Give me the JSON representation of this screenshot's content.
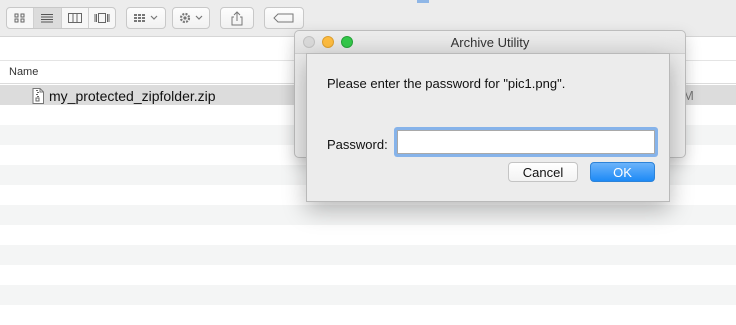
{
  "toolbar": {
    "view_buttons": [
      "icon-view",
      "list-view",
      "column-view",
      "cover-flow-view"
    ],
    "active_view": "list-view"
  },
  "file_list": {
    "column_name": "Name",
    "selected_file": "my_protected_zipfolder.zip",
    "partial_column_tail": "M"
  },
  "background_window": {
    "title": "Archive Utility"
  },
  "dialog": {
    "prompt": "Please enter the password for \"pic1.png\".",
    "password_label": "Password:",
    "password_value": "",
    "cancel_label": "Cancel",
    "ok_label": "OK"
  },
  "colors": {
    "accent": "#1d8af6",
    "focus_ring": "#86b3ea",
    "close": "#fc605c",
    "minimize": "#fdbc40",
    "zoom": "#34c84a"
  }
}
